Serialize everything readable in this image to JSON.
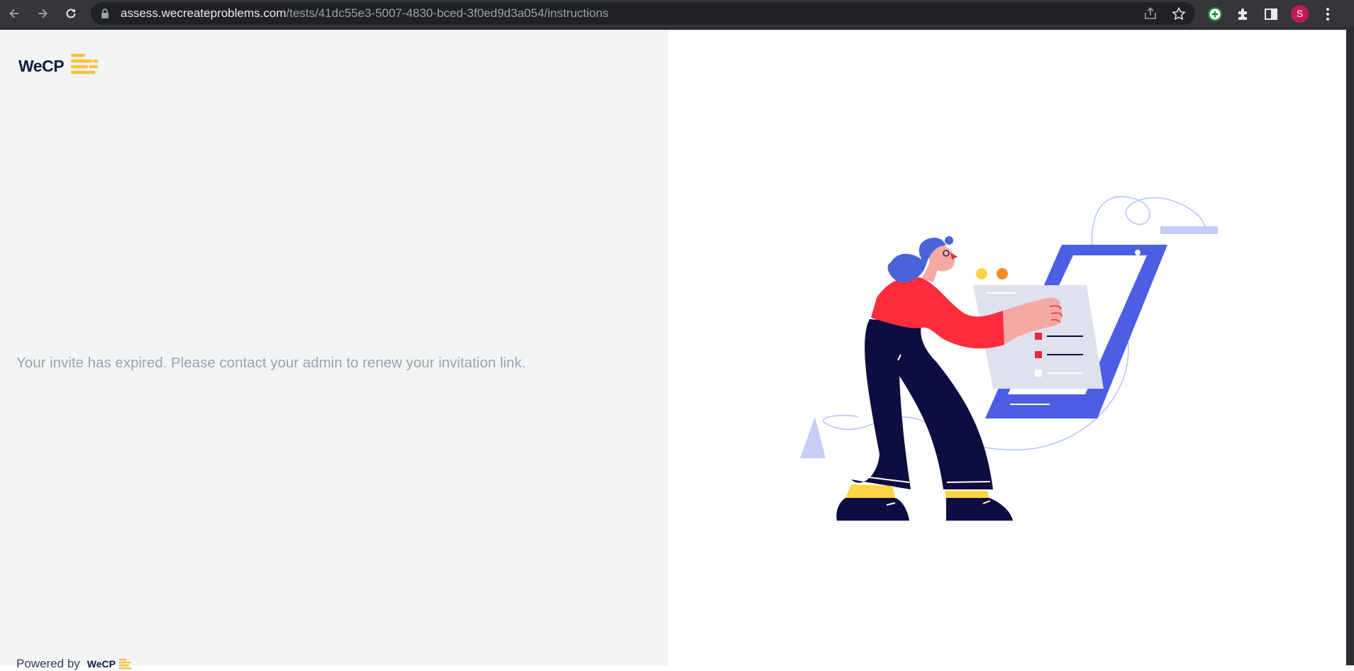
{
  "browser": {
    "url_host": "assess.wecreateproblems.com",
    "url_path": "/tests/41dc55e3-5007-4830-bced-3f0ed9d3a054/instructions",
    "profile_initial": "S",
    "icons": [
      "back-icon",
      "forward-icon",
      "reload-icon",
      "lock-icon",
      "share-icon",
      "star-icon",
      "add-extension-icon",
      "extensions-icon",
      "side-panel-icon",
      "menu-icon"
    ]
  },
  "brand": {
    "logo_text": "WeCP",
    "accent_color": "#f9c23c",
    "navy": "#0b1f3a"
  },
  "main": {
    "message": "Your invite has expired. Please contact your admin to renew your invitation link."
  },
  "footer": {
    "powered_by": "Powered by",
    "logo_text": "WeCP"
  },
  "illustration": {
    "subject": "woman holding checklist tablet",
    "colors": {
      "tablet": "#4b5ee4",
      "shirt": "#ff2d3b",
      "pants": "#0e0d3f",
      "hair": "#4a63d8",
      "shoes": "#fdd443"
    }
  }
}
